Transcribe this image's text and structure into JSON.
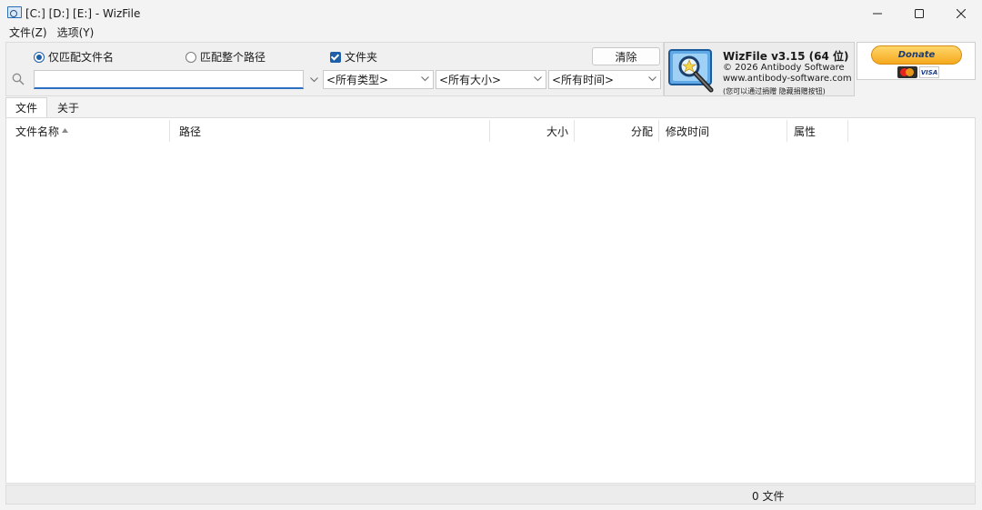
{
  "window": {
    "title": "[C:] [D:] [E:]  - WizFile"
  },
  "menu": {
    "items": [
      "文件(Z)",
      "选项(Y)"
    ]
  },
  "search": {
    "radio_filename_only": "仅匹配文件名",
    "radio_full_path": "匹配整个路径",
    "checkbox_folders": "文件夹",
    "clear_label": "清除",
    "query_value": "",
    "type_filter": "<所有类型>",
    "size_filter": "<所有大小>",
    "time_filter": "<所有时间>"
  },
  "logo": {
    "title": "WizFile v3.15 (64 位)",
    "copyright": "© 2026 Antibody Software",
    "website": "www.antibody-software.com",
    "note": "(您可以通过捐赠 隐藏捐赠按钮)"
  },
  "donate": {
    "label": "Donate",
    "visa": "VISA"
  },
  "tabs": [
    {
      "label": "文件",
      "active": true
    },
    {
      "label": "关于",
      "active": false
    }
  ],
  "columns": {
    "name": "文件名称",
    "path": "路径",
    "size": "大小",
    "alloc": "分配",
    "modified": "修改时间",
    "attributes": "属性"
  },
  "status": {
    "file_count": "0 文件"
  },
  "colors": {
    "accent": "#1f5fa8",
    "window_bg": "#f3f3f3"
  }
}
